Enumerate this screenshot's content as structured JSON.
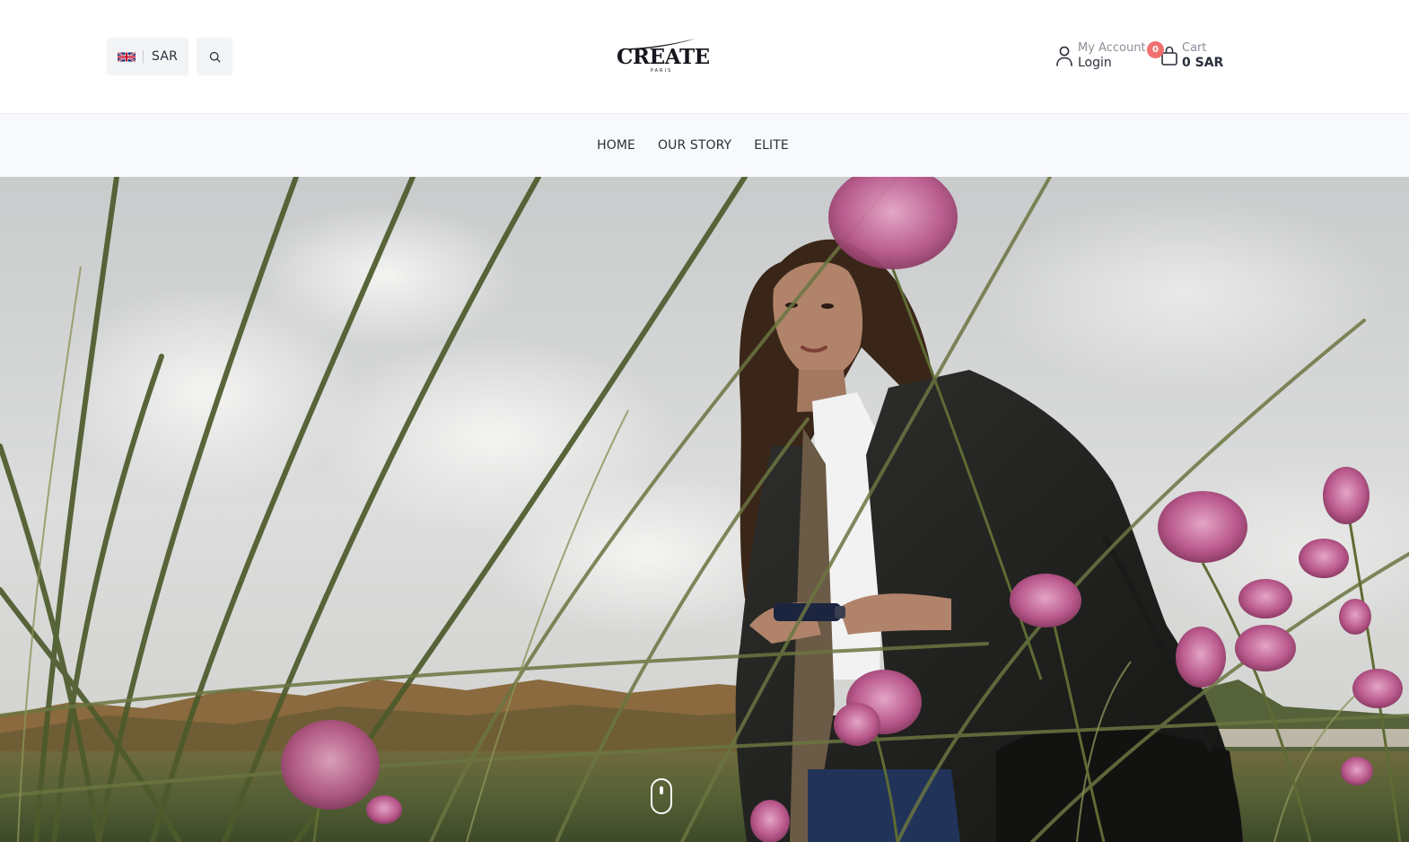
{
  "header": {
    "currency": {
      "code": "SAR",
      "flag_icon": "uk-flag-icon"
    },
    "search": {
      "icon": "search-icon"
    },
    "logo": {
      "name": "CREATE",
      "subtitle": "PARIS"
    },
    "account": {
      "top_label": "My Account",
      "bottom_label": "Login",
      "icon": "user-icon"
    },
    "cart": {
      "count": "0",
      "top_label": "Cart",
      "total": "0 SAR",
      "icon": "shopping-bag-icon"
    }
  },
  "nav": {
    "items": [
      {
        "label": "HOME"
      },
      {
        "label": "OUR STORY"
      },
      {
        "label": "ELITE"
      }
    ]
  },
  "hero": {
    "image_subject": "woman in leather jacket holding lipstick in a grassy field with pink flowers",
    "scroll_icon": "mouse-scroll-icon"
  },
  "colors": {
    "badge": "#f07070",
    "nav_background": "#f8f9fb",
    "button_background": "#f3f4f6",
    "text": "#2a2f3a"
  }
}
